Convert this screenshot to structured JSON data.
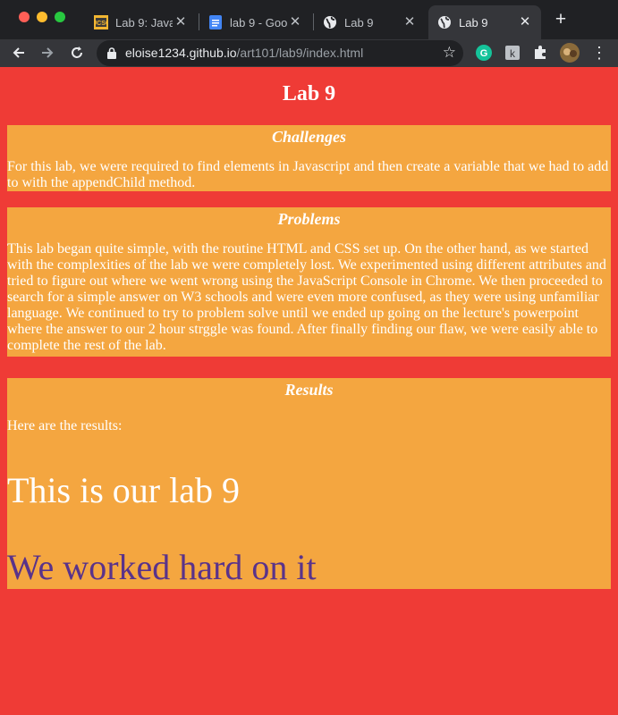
{
  "tabs": [
    {
      "title": "Lab 9: Java",
      "icon": "ucsc-favicon",
      "active": false
    },
    {
      "title": "lab 9 - Goo",
      "icon": "google-docs-icon",
      "active": false
    },
    {
      "title": "Lab 9",
      "icon": "globe-icon",
      "active": false
    },
    {
      "title": "Lab 9",
      "icon": "globe-icon",
      "active": true
    }
  ],
  "toolbar": {
    "url_host": "eloise1234.github.io",
    "url_path": "/art101/lab9/index.html"
  },
  "page": {
    "heading": "Lab 9",
    "sections": [
      {
        "title": "Challenges",
        "body": "For this lab, we were required to find elements in Javascript and then create a variable that we had to add to with the appendChild method."
      },
      {
        "title": "Problems",
        "body": "This lab began quite simple, with the routine HTML and CSS set up. On the other hand, as we started with the complexities of the lab we were completely lost. We experimented using different attributes and tried to figure out where we went wrong using the JavaScript Console in Chrome. We then proceeded to search for a simple answer on W3 schools and were even more confused, as they were using unfamiliar language. We continued to try to problem solve until we ended up going on the lecture's powerpoint where the answer to our 2 hour strggle was found. After finally finding our flaw, we were easily able to complete the rest of the lab."
      },
      {
        "title": "Results",
        "intro": "Here are the results:",
        "line1": "This is our lab 9",
        "line2": "We worked hard on it"
      }
    ]
  },
  "colors": {
    "page_background": "#ef3b36",
    "section_background": "#f4a640",
    "purple_text": "#5a338a"
  }
}
